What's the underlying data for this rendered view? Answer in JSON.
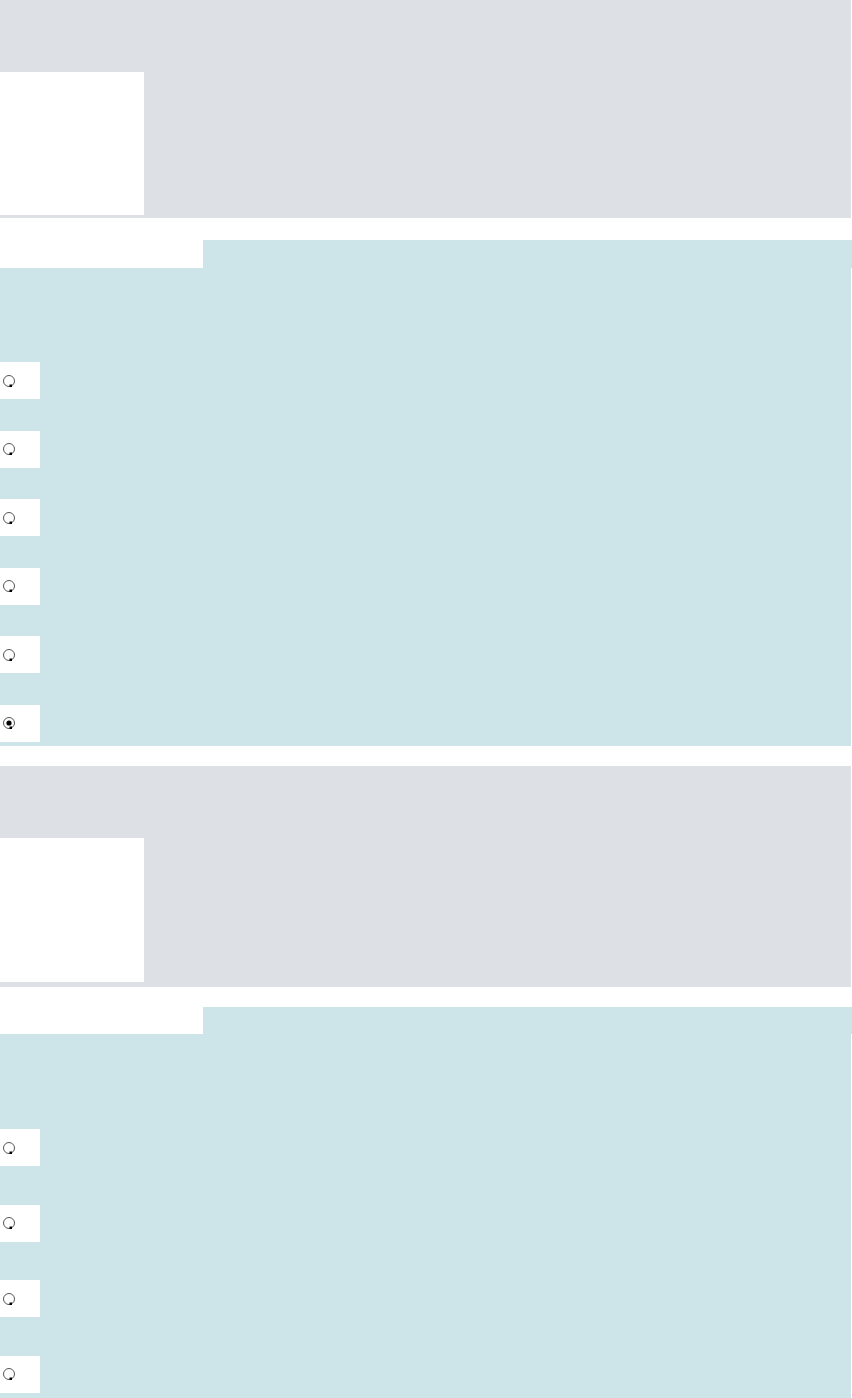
{
  "questions": [
    {
      "options": [
        {
          "selected": false
        },
        {
          "selected": false
        },
        {
          "selected": false
        },
        {
          "selected": false
        },
        {
          "selected": false
        },
        {
          "selected": true
        }
      ]
    },
    {
      "options": [
        {
          "selected": false
        },
        {
          "selected": false
        },
        {
          "selected": false
        },
        {
          "selected": false
        }
      ]
    }
  ]
}
